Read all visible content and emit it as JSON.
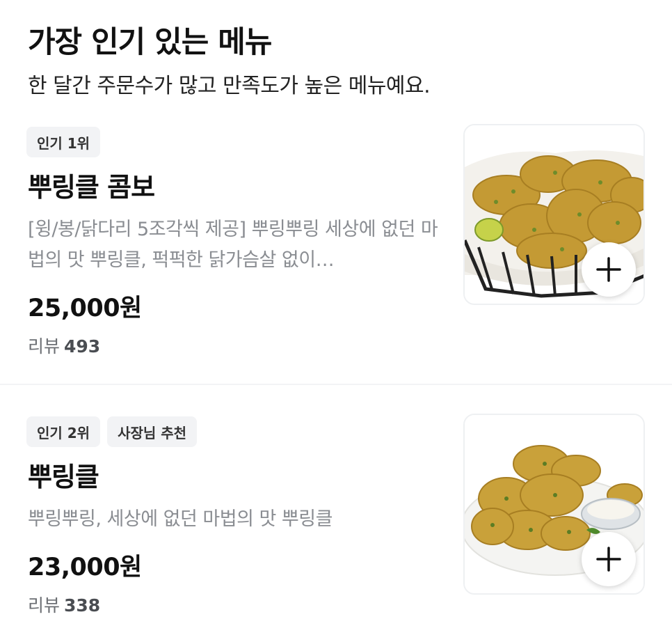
{
  "section": {
    "title": "가장 인기 있는 메뉴",
    "subtitle": "한 달간 주문수가 많고 만족도가 높은 메뉴예요."
  },
  "items": [
    {
      "badges": [
        "인기 1위"
      ],
      "name": "뿌링클 콤보",
      "description": "[윙/봉/닭다리 5조각씩 제공] 뿌링뿌링 세상에 없던 마법의 맛 뿌링클, 퍽퍽한 닭가슴살 없이…",
      "price": "25,000원",
      "review_label": "리뷰",
      "review_count": "493",
      "image_icon": "fried-chicken-basket-photo",
      "add_icon": "plus-icon"
    },
    {
      "badges": [
        "인기 2위",
        "사장님 추천"
      ],
      "name": "뿌링클",
      "description": "뿌링뿌링, 세상에 없던 마법의 맛 뿌링클",
      "price": "23,000원",
      "review_label": "리뷰",
      "review_count": "338",
      "image_icon": "fried-chicken-plate-photo",
      "add_icon": "plus-icon"
    }
  ],
  "colors": {
    "badge_bg": "#f2f3f5",
    "chicken": "#c9a33a",
    "desc_text": "#8a8d92"
  }
}
